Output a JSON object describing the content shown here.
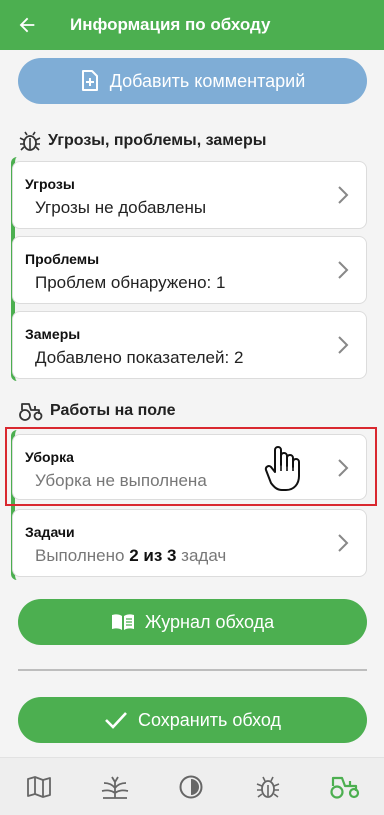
{
  "header": {
    "title": "Информация по обходу"
  },
  "comment_button": {
    "label": "Добавить комментарий"
  },
  "section_threats": {
    "title": "Угрозы, проблемы, замеры"
  },
  "threats_cards": [
    {
      "label": "Угрозы",
      "value": "Угрозы не добавлены"
    },
    {
      "label": "Проблемы",
      "value": "Проблем обнаружено: 1"
    },
    {
      "label": "Замеры",
      "value": "Добавлено показателей: 2"
    }
  ],
  "section_works": {
    "title": "Работы на поле"
  },
  "harvest_card": {
    "label": "Уборка",
    "value": "Уборка не выполнена"
  },
  "tasks_card": {
    "label": "Задачи",
    "prefix": "Выполнено ",
    "count": "2 из 3",
    "suffix": " задач"
  },
  "journal_button": {
    "label": "Журнал обхода"
  },
  "save_button": {
    "label": "Сохранить обход"
  },
  "bottom_nav": [
    "map-icon",
    "crop-icon",
    "phase-icon",
    "bug-icon",
    "tractor-icon"
  ],
  "colors": {
    "primary": "#4caf50",
    "comment_button": "#7fadd6",
    "highlight": "#d9282f"
  }
}
